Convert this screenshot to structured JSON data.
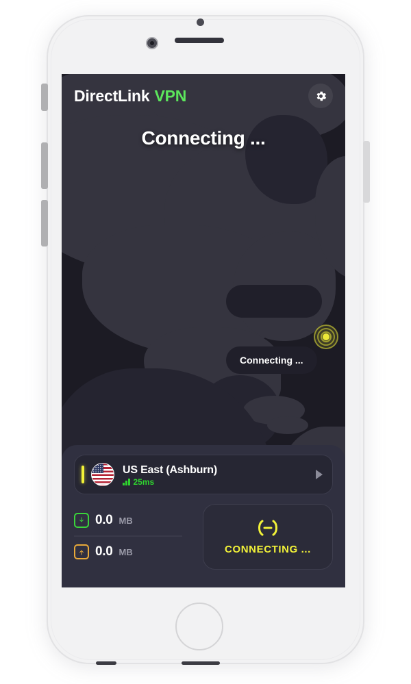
{
  "device": {
    "type": "smartphone-mockup",
    "frame_color": "#f2f2f3",
    "screen_bg": "#1c1b24"
  },
  "app": {
    "brand_primary": "DirectLink",
    "brand_accent": "VPN",
    "brand_accent_color": "#5ce65c",
    "settings_icon": "gear-icon"
  },
  "status": {
    "headline": "Connecting ...",
    "map_tooltip": "Connecting ...",
    "marker_color": "#ece838",
    "marker_state": "pulsing"
  },
  "server": {
    "name": "US East (Ashburn)",
    "flag": "us-flag-icon",
    "ping": "25ms",
    "ping_color": "#2fd32f",
    "signal_bars": 3,
    "accent_color": "#f2f238",
    "chevron_icon": "chevron-right-icon"
  },
  "stats": {
    "download": {
      "icon": "download-icon",
      "icon_color": "#3ad43a",
      "value": "0.0",
      "unit": "MB"
    },
    "upload": {
      "icon": "upload-icon",
      "icon_color": "#e8a93a",
      "value": "0.0",
      "unit": "MB"
    }
  },
  "connect_button": {
    "label": "CONNECTING ...",
    "icon": "power-connecting-icon",
    "color": "#f2f238"
  }
}
